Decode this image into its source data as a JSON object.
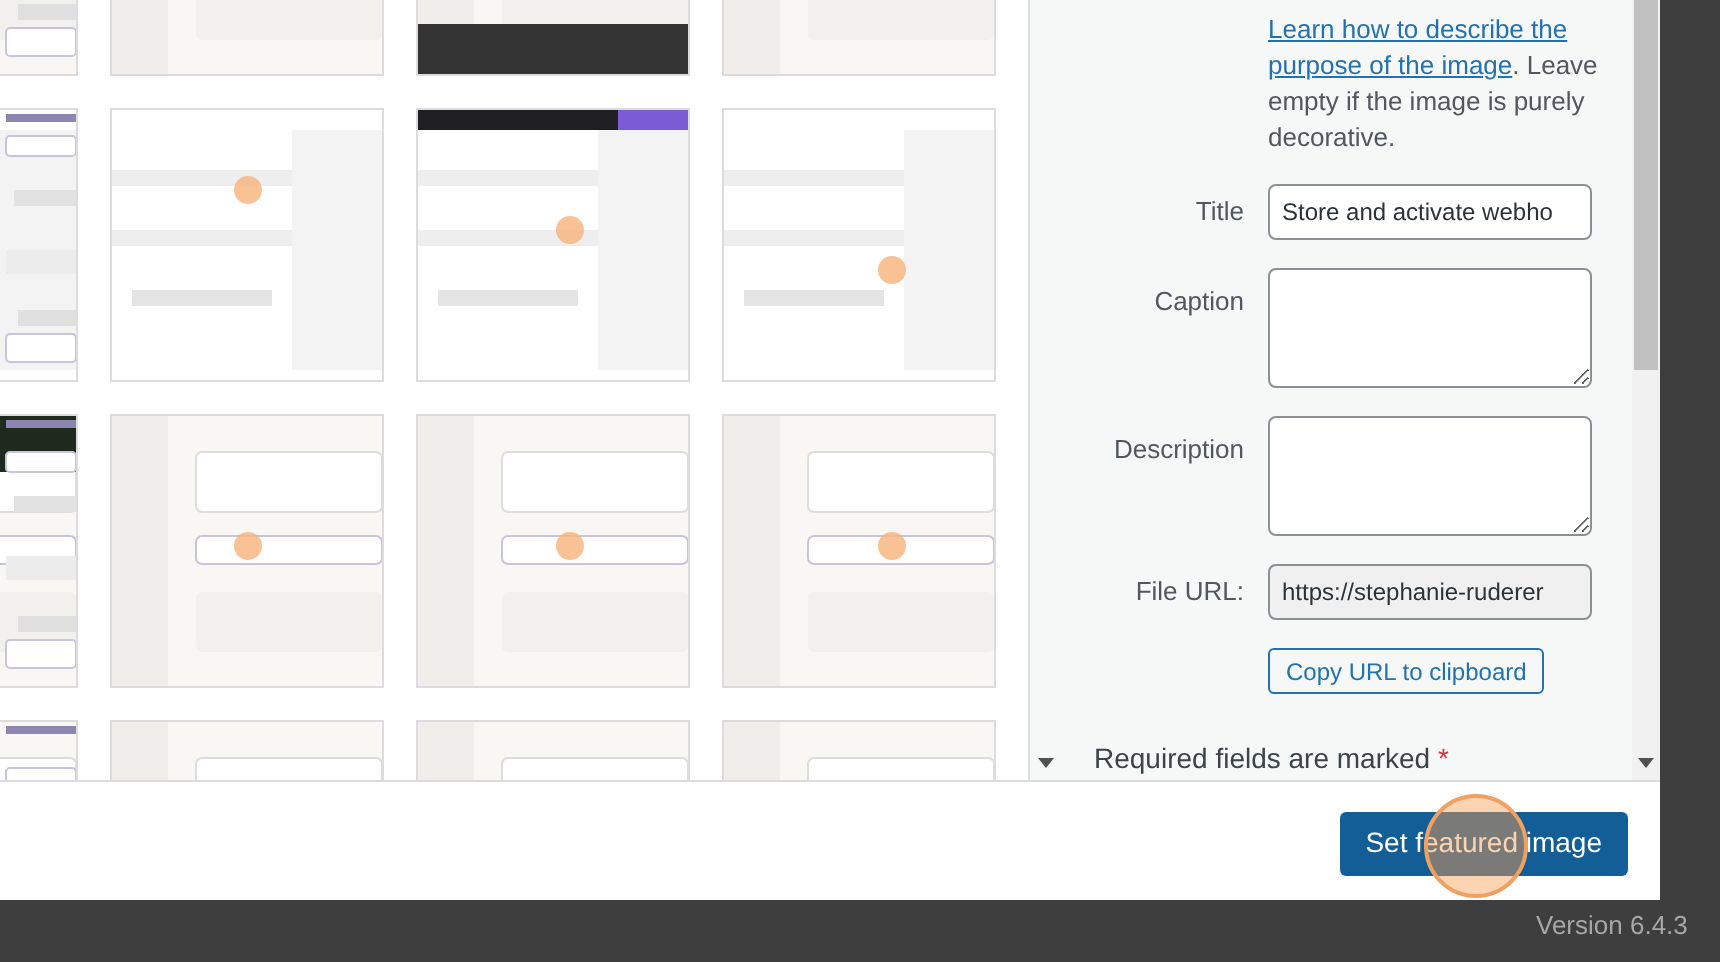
{
  "details": {
    "alt_help": {
      "link_lines": [
        "Learn how to describe the",
        "purpose of the image"
      ],
      "text": ". Leave empty if the image is purely decorative."
    },
    "fields": [
      {
        "kind": "input",
        "label": "Title",
        "value": "Store and activate webho"
      },
      {
        "kind": "textarea",
        "label": "Caption"
      },
      {
        "kind": "textarea",
        "label": "Description"
      },
      {
        "kind": "readonly",
        "label": "File URL:",
        "value": "https://stephanie-ruderer"
      }
    ],
    "copy_button": "Copy URL to clipboard",
    "required_note": {
      "text": "Required fields are marked",
      "mark": "*"
    }
  },
  "toolbar": {
    "primary_button": "Set featured image"
  },
  "click_indicator": true,
  "footer": {
    "version": "Version 6.4.3"
  }
}
